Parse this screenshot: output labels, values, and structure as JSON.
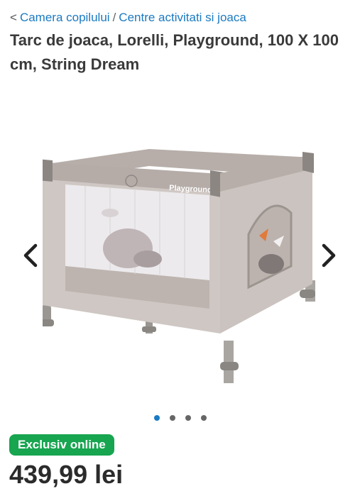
{
  "breadcrumb": {
    "back_glyph": "<",
    "items": [
      {
        "label": "Camera copilului"
      },
      {
        "label": "Centre activitati si joaca"
      }
    ],
    "separator": "/"
  },
  "product": {
    "title": "Tarc de joaca, Lorelli, Playground, 100 X 100 cm, String Dream",
    "image": {
      "icon": "playpen-image",
      "printed_label": "Playground"
    },
    "badge": "Exclusiv online",
    "price": "439,99 lei"
  },
  "gallery": {
    "prev_icon": "chevron-left-icon",
    "next_icon": "chevron-right-icon",
    "dots_total": 4,
    "active_dot": 1
  },
  "colors": {
    "link": "#1a7ac2",
    "badge_bg": "#17a550",
    "dot_active": "#1a7ac2",
    "dot_inactive": "#666666"
  }
}
